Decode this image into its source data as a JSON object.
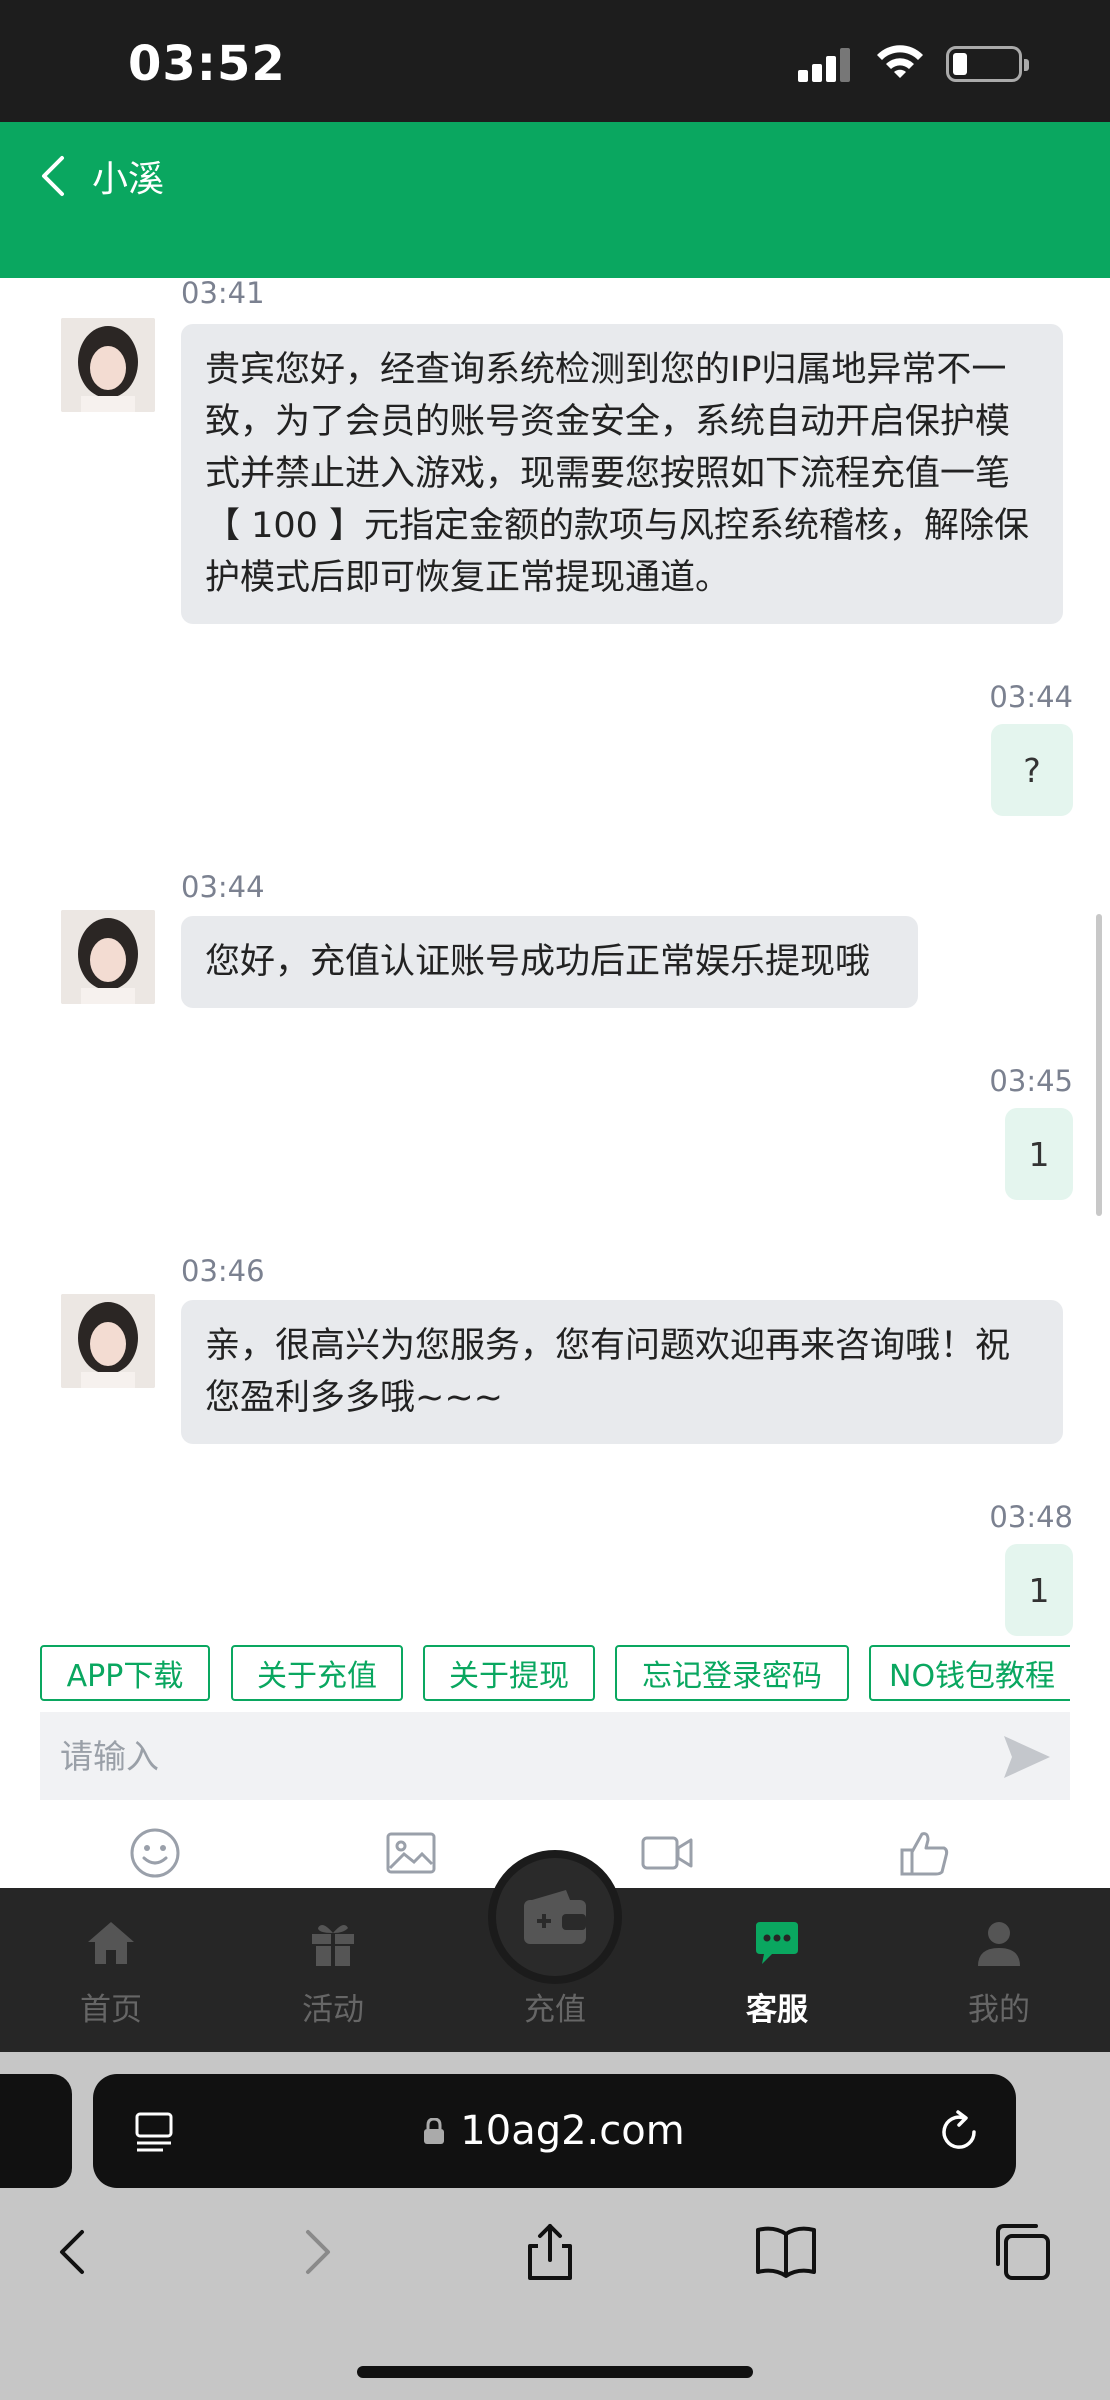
{
  "status": {
    "time": "03:52"
  },
  "header": {
    "title": "小溪"
  },
  "messages": [
    {
      "direction": "in",
      "time": "03:41",
      "text": "贵宾您好，经查询系统检测到您的IP归属地异常不一致，为了会员的账号资金安全，系统自动开启保护模式并禁止进入游戏，现需要您按照如下流程充值一笔【 100 】元指定金额的款项与风控系统稽核，解除保护模式后即可恢复正常提现通道。"
    },
    {
      "direction": "out",
      "time": "03:44",
      "text": "?"
    },
    {
      "direction": "in",
      "time": "03:44",
      "text": "您好，充值认证账号成功后正常娱乐提现哦"
    },
    {
      "direction": "out",
      "time": "03:45",
      "text": "1"
    },
    {
      "direction": "in",
      "time": "03:46",
      "text": "亲，很高兴为您服务，您有问题欢迎再来咨询哦！祝您盈利多多哦~~~"
    },
    {
      "direction": "out",
      "time": "03:48",
      "text": "1"
    }
  ],
  "quick_replies": [
    "APP下载",
    "关于充值",
    "关于提现",
    "忘记登录密码",
    "NO钱包教程"
  ],
  "input": {
    "placeholder": "请输入"
  },
  "tools": [
    "emoji-icon",
    "image-icon",
    "video-icon",
    "like-icon"
  ],
  "nav": {
    "items": [
      {
        "label": "首页",
        "icon": "home-icon"
      },
      {
        "label": "活动",
        "icon": "gift-icon"
      },
      {
        "label": "充值",
        "icon": "wallet-icon"
      },
      {
        "label": "客服",
        "icon": "chat-icon",
        "active": true
      },
      {
        "label": "我的",
        "icon": "user-icon"
      }
    ]
  },
  "browser": {
    "url": "10ag2.com"
  },
  "colors": {
    "accent": "#0aa760",
    "bubble_in": "#e8eaed",
    "bubble_out": "#e4f5ee",
    "nav_bg": "#262626"
  }
}
